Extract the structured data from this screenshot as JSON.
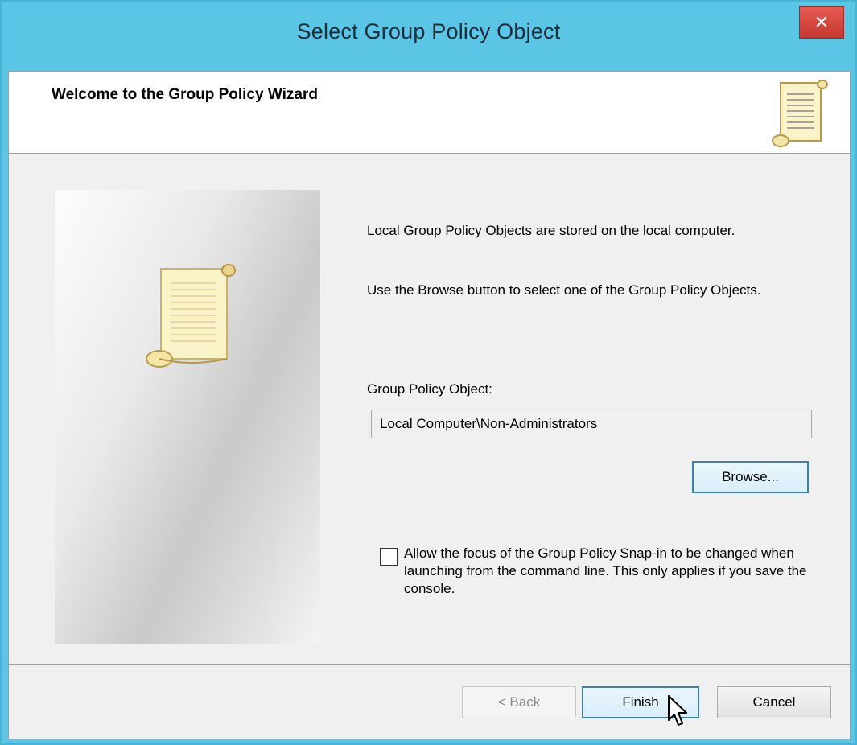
{
  "window": {
    "title": "Select Group Policy Object"
  },
  "header": {
    "title": "Welcome to the Group Policy Wizard"
  },
  "body": {
    "paragraph1": "Local Group Policy Objects are stored on the local computer.",
    "paragraph2": "Use the Browse button to select one of the Group Policy Objects.",
    "gpo_label": "Group Policy Object:",
    "gpo_value": "Local Computer\\Non-Administrators",
    "browse_label": "Browse...",
    "checkbox_label": "Allow the focus of the Group Policy Snap-in to be changed when launching from the command line.  This only applies if you save the console.",
    "checkbox_checked": false
  },
  "footer": {
    "back_label": "< Back",
    "finish_label": "Finish",
    "cancel_label": "Cancel"
  },
  "colors": {
    "titlebar": "#5bc5e6",
    "close_button": "#c7382f",
    "dialog_background": "#f0f0f0",
    "focus_border": "#3c7fb1"
  },
  "icons": {
    "close": "close-icon",
    "header": "scroll-icon",
    "sidebar": "scroll-icon",
    "cursor": "mouse-pointer-icon"
  }
}
